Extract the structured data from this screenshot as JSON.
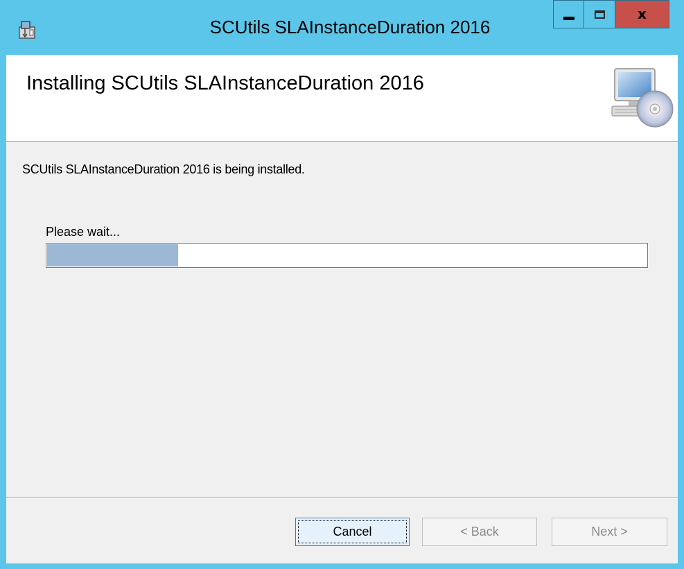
{
  "window": {
    "title": "SCUtils SLAInstanceDuration 2016",
    "close_glyph": "x",
    "icons": {
      "app": "installer-icon",
      "minimize": "minimize-icon",
      "maximize": "maximize-icon",
      "close": "close-icon"
    }
  },
  "header": {
    "title": "Installing SCUtils SLAInstanceDuration 2016",
    "art_icon": "computer-with-cd-icon"
  },
  "body": {
    "status": "SCUtils SLAInstanceDuration 2016 is being installed.",
    "wait_label": "Please wait...",
    "progress": 0.22
  },
  "buttons": {
    "cancel": "Cancel",
    "back": "< Back",
    "next": "Next >"
  },
  "colors": {
    "title_bar": "#5bc6ea",
    "close_button": "#c7504a",
    "progress_fill": "#9cb8d4"
  }
}
